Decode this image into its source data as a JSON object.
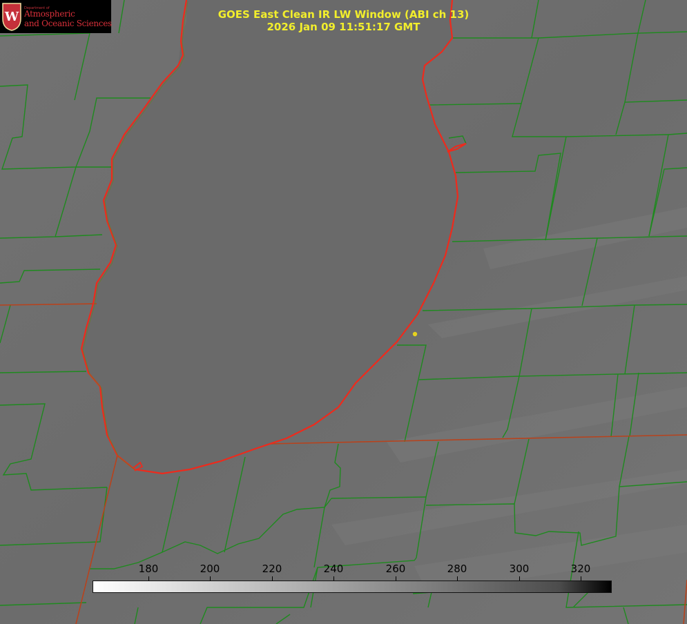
{
  "logo": {
    "department": "Department of",
    "line1": "Atmospheric",
    "line2": "and Oceanic Sciences",
    "seal_letter": "W"
  },
  "title": {
    "line1": "GOES East Clean IR LW Window (ABI ch 13)",
    "line2": "2026 Jan 09 11:51:17 GMT"
  },
  "colorbar": {
    "ticks": [
      "180",
      "200",
      "220",
      "240",
      "260",
      "280",
      "300",
      "320"
    ],
    "min_color": "#ffffff",
    "max_color": "#000000"
  },
  "colors": {
    "background": "#6e6e6e",
    "lake": "#6a6a6a",
    "county_lines": "#1e8a1e",
    "shoreline": "#ee2a1c",
    "state_lines": "#b8421c",
    "title_text": "#f2ee2c",
    "marker": "#e6d21e"
  }
}
